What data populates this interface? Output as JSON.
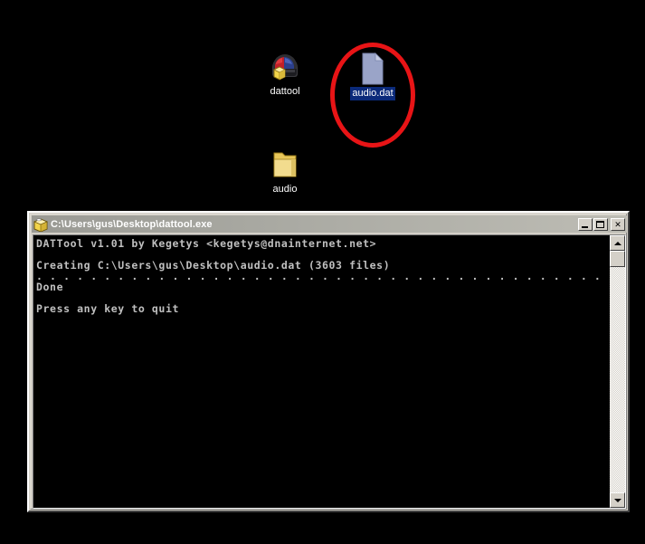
{
  "desktop": {
    "background_color": "#000000",
    "icons": [
      {
        "label": "dattool",
        "icon": "helmet-package-icon",
        "selected": false
      },
      {
        "label": "audio.dat",
        "icon": "document-file-icon",
        "selected": true
      },
      {
        "label": "audio",
        "icon": "folder-icon",
        "selected": false
      }
    ]
  },
  "annotation": {
    "shape": "ellipse",
    "color": "#e81416",
    "target": "audio.dat"
  },
  "console_window": {
    "title": "C:\\Users\\gus\\Desktop\\dattool.exe",
    "title_icon": "package-box-icon",
    "buttons": {
      "minimize": "minimize-icon",
      "maximize": "maximize-icon",
      "close": "✕"
    },
    "output": "DATTool v1.01 by Kegetys <kegetys@dnainternet.net>\n\nCreating C:\\Users\\gus\\Desktop\\audio.dat (3603 files)\n. . . . . . . . . . . . . . . . . . . . . . . . . . . . . . . . . . . . . . . . . . . . . . . . . . . . .\nDone\n\nPress any key to quit",
    "scrollbar": {
      "up_arrow": "scroll-up-icon",
      "down_arrow": "scroll-down-icon"
    }
  }
}
